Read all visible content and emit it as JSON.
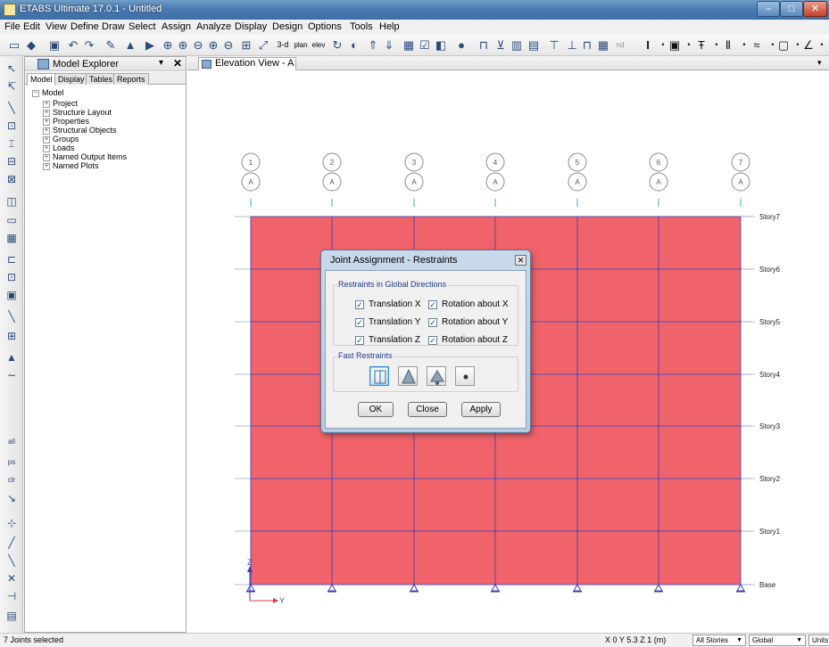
{
  "window": {
    "title": "ETABS Ultimate 17.0.1 - Untitled",
    "min": "–",
    "max": "□",
    "close": "✕"
  },
  "menu": [
    "File",
    "Edit",
    "View",
    "Define",
    "Draw",
    "Select",
    "Assign",
    "Analyze",
    "Display",
    "Design",
    "Options",
    "Tools",
    "Help"
  ],
  "toolbar": {
    "icons": [
      "new-icon",
      "open-icon",
      "save-icon",
      "undo-icon",
      "redo-icon",
      "pencil-icon",
      "lock-icon",
      "pointer-icon",
      "zoom-window-icon",
      "zoom-in-icon",
      "zoom-out-icon",
      "zoom-fit-icon",
      "zoom-prev-icon",
      "3d-view-icon",
      "perspective-icon"
    ],
    "text_items": [
      "3-d",
      "plan",
      "elev",
      "nd"
    ]
  },
  "explorer": {
    "title": "Model Explorer",
    "pin": "▾",
    "close": "✕",
    "tabs": [
      "Model",
      "Display",
      "Tables",
      "Reports"
    ],
    "root": "Model",
    "items": [
      "Project",
      "Structure Layout",
      "Properties",
      "Structural Objects",
      "Groups",
      "Loads",
      "Named Output Items",
      "Named Plots"
    ]
  },
  "doc": {
    "tab": "Elevation View - A",
    "dropdown": "▾"
  },
  "elevation": {
    "grid_columns": [
      "1",
      "2",
      "3",
      "4",
      "5",
      "6",
      "7"
    ],
    "grid_row": "A",
    "stories": [
      "Story7",
      "Story6",
      "Story5",
      "Story4",
      "Story3",
      "Story2",
      "Story1",
      "Base"
    ],
    "axis_z": "Z",
    "axis_y": "Y",
    "fill_color": "#f0636a",
    "line_color": "#3a3ab8"
  },
  "dialog": {
    "title": "Joint Assignment - Restraints",
    "close": "✕",
    "group1": "Restraints in Global Directions",
    "checks": [
      {
        "label": "Translation X",
        "checked": "✓"
      },
      {
        "label": "Rotation about X",
        "checked": "✓"
      },
      {
        "label": "Translation Y",
        "checked": "✓"
      },
      {
        "label": "Rotation about Y",
        "checked": "✓"
      },
      {
        "label": "Translation Z",
        "checked": "✓"
      },
      {
        "label": "Rotation about Z",
        "checked": "✓"
      }
    ],
    "group2": "Fast Restraints",
    "buttons": [
      "OK",
      "Close",
      "Apply"
    ]
  },
  "status": {
    "selection": "7 Joints selected",
    "coords": "X 0  Y 5.3  Z 1 (m)",
    "stories": "All Stories",
    "system": "Global",
    "units": "Units..."
  }
}
